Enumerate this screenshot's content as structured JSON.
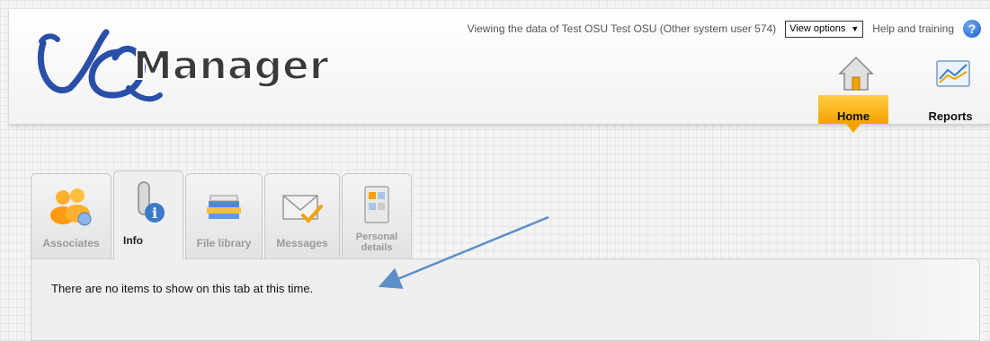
{
  "app": {
    "logo_text": "VQManager"
  },
  "topbar": {
    "viewing_text": "Viewing the data of Test OSU Test OSU (Other system user 574)",
    "view_options_label": "View options",
    "help_label": "Help and training"
  },
  "nav": {
    "home_label": "Home",
    "reports_label": "Reports",
    "active": "Home"
  },
  "tabs": [
    {
      "label": "Associates",
      "icon": "associates-icon"
    },
    {
      "label": "Info",
      "icon": "info-icon",
      "active": true
    },
    {
      "label": "File library",
      "icon": "file-library-icon"
    },
    {
      "label": "Messages",
      "icon": "messages-icon"
    },
    {
      "label": "Personal details",
      "icon": "personal-details-icon"
    }
  ],
  "panel": {
    "message": "There are no items to show on this tab at this time."
  },
  "colors": {
    "accent": "#f4a300",
    "help_blue": "#1e5fcc",
    "arrow": "#5b8fc7"
  }
}
